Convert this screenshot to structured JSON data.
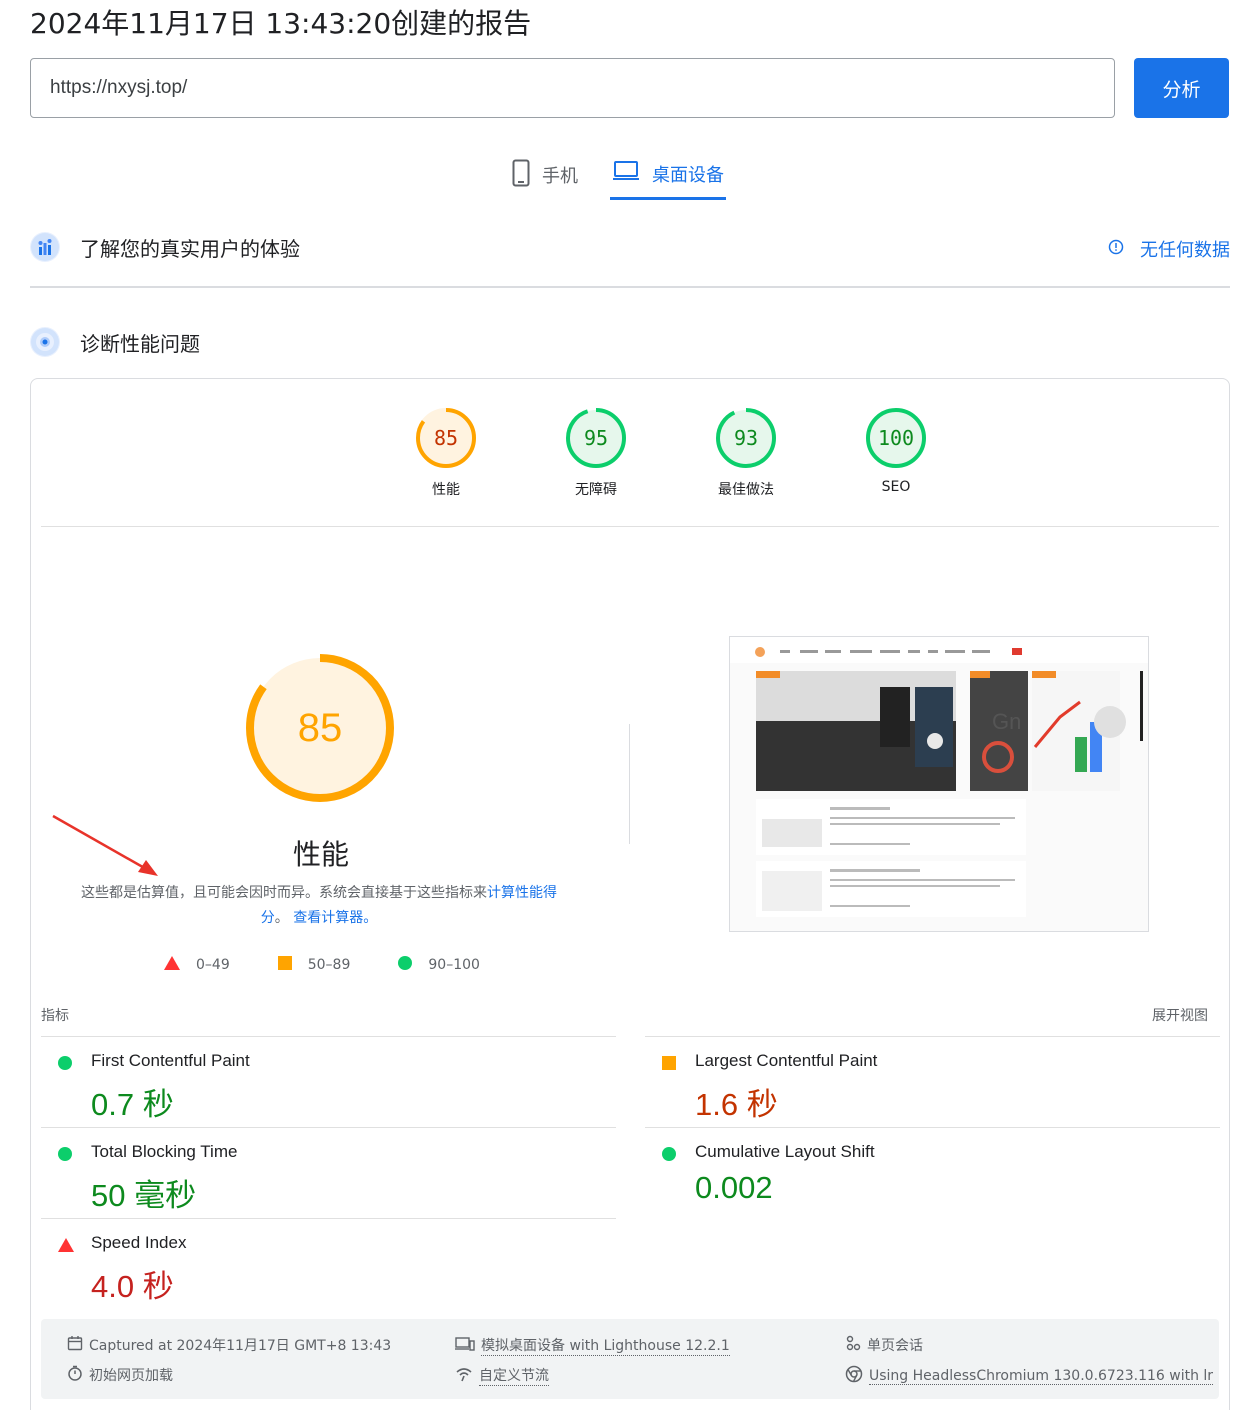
{
  "header": {
    "report_title": "2024年11月17日 13:43:20创建的报告",
    "url_value": "https://nxysj.top/",
    "analyze_label": "分析"
  },
  "device_tabs": [
    {
      "label": "手机",
      "icon": "phone-icon",
      "active": false
    },
    {
      "label": "桌面设备",
      "icon": "laptop-icon",
      "active": true
    }
  ],
  "field_data": {
    "title": "了解您的真实用户的体验",
    "no_data": "无任何数据"
  },
  "lab_data": {
    "title": "诊断性能问题"
  },
  "category_scores": [
    {
      "label": "性能",
      "score": "85",
      "value": 85,
      "status": "average"
    },
    {
      "label": "无障碍",
      "score": "95",
      "value": 95,
      "status": "pass"
    },
    {
      "label": "最佳做法",
      "score": "93",
      "value": 93,
      "status": "pass"
    },
    {
      "label": "SEO",
      "score": "100",
      "value": 100,
      "status": "pass"
    }
  ],
  "performance": {
    "score": "85",
    "value": 85,
    "title": "性能",
    "desc_text": "这些都是估算值，且可能会因时而异。系统会直接基于这些指标来",
    "desc_link": "计算性能得分",
    "desc_sep": "。",
    "desc_link2": "查看计算器。"
  },
  "legend": [
    {
      "range": "0–49",
      "shape": "triangle",
      "color": "#ff3333"
    },
    {
      "range": "50–89",
      "shape": "square",
      "color": "#ffa400"
    },
    {
      "range": "90–100",
      "shape": "circle",
      "color": "#0cce6b"
    }
  ],
  "metrics": {
    "header": "指标",
    "expand": "展开视图",
    "items": [
      {
        "name": "First Contentful Paint",
        "value": "0.7 秒",
        "status": "pass"
      },
      {
        "name": "Largest Contentful Paint",
        "value": "1.6 秒",
        "status": "average"
      },
      {
        "name": "Total Blocking Time",
        "value": "50 毫秒",
        "status": "pass"
      },
      {
        "name": "Cumulative Layout Shift",
        "value": "0.002",
        "status": "pass"
      },
      {
        "name": "Speed Index",
        "value": "4.0 秒",
        "status": "fail"
      }
    ]
  },
  "footer": {
    "captured": "Captured at 2024年11月17日 GMT+8 13:43",
    "initial_load": "初始网页加载",
    "emulated": "模拟桌面设备 with Lighthouse 12.2.1",
    "throttling": "自定义节流",
    "session": "单页会话",
    "browser": "Using HeadlessChromium 130.0.6723.116 with lr"
  },
  "colors": {
    "accent": "#1a73e8",
    "pass": "#0cce6b",
    "average": "#ffa400",
    "fail": "#ff3333"
  }
}
